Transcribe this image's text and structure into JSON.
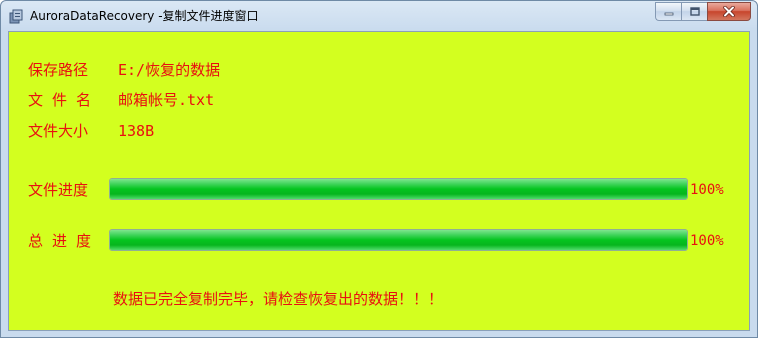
{
  "window": {
    "title": "AuroraDataRecovery -复制文件进度窗口",
    "client_bg": "#d3ff1f",
    "text_color": "#e81010"
  },
  "info": {
    "save_path_label": "保存路径",
    "save_path_value": "E:/恢复的数据",
    "file_name_label": "文 件 名",
    "file_name_value": "邮箱帐号.txt",
    "file_size_label": "文件大小",
    "file_size_value": "138B"
  },
  "progress": {
    "file_label": "文件进度",
    "file_percent_text": "100%",
    "file_value": 1.0,
    "total_label": "总 进 度",
    "total_percent_text": "100%",
    "total_value": 1.0
  },
  "message": "数据已完全复制完毕，请检查恢复出的数据！！！"
}
